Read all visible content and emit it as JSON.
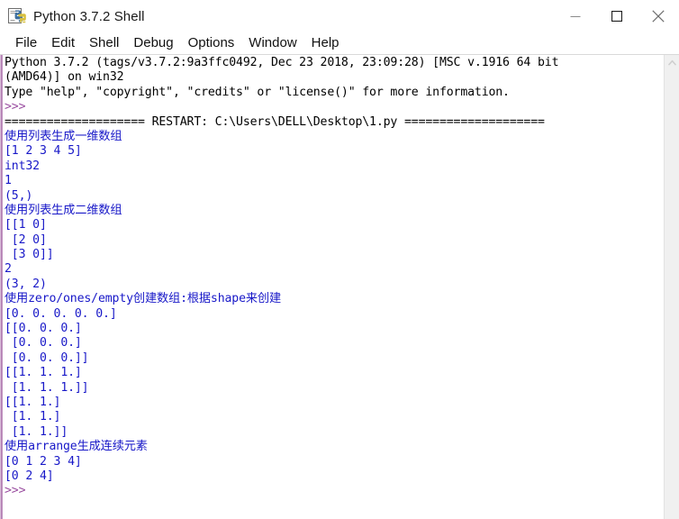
{
  "window": {
    "title": "Python 3.7.2 Shell",
    "icon": "python-idle-icon",
    "controls": {
      "minimize": "minimize-icon",
      "maximize": "maximize-icon",
      "close": "close-icon"
    }
  },
  "menubar": {
    "items": [
      {
        "label": "File"
      },
      {
        "label": "Edit"
      },
      {
        "label": "Shell"
      },
      {
        "label": "Debug"
      },
      {
        "label": "Options"
      },
      {
        "label": "Window"
      },
      {
        "label": "Help"
      }
    ]
  },
  "colors": {
    "output_blue": "#1818c8",
    "stdout_black": "#000000",
    "prompt_purple": "#9a4ea0",
    "left_border": "#b07ab0",
    "scrollbar_track": "#f0f0f0"
  },
  "shell": {
    "lines": [
      {
        "color": "black",
        "text": "Python 3.7.2 (tags/v3.7.2:9a3ffc0492, Dec 23 2018, 23:09:28) [MSC v.1916 64 bit"
      },
      {
        "color": "black",
        "text": "(AMD64)] on win32"
      },
      {
        "color": "black",
        "text": "Type \"help\", \"copyright\", \"credits\" or \"license()\" for more information."
      },
      {
        "color": "prompt",
        "text": ">>>"
      },
      {
        "color": "black",
        "text": "==================== RESTART: C:\\Users\\DELL\\Desktop\\1.py ===================="
      },
      {
        "color": "blue",
        "text": "使用列表生成一维数组"
      },
      {
        "color": "blue",
        "text": "[1 2 3 4 5]"
      },
      {
        "color": "blue",
        "text": "int32"
      },
      {
        "color": "blue",
        "text": "1"
      },
      {
        "color": "blue",
        "text": "(5,)"
      },
      {
        "color": "blue",
        "text": "使用列表生成二维数组"
      },
      {
        "color": "blue",
        "text": "[[1 0]"
      },
      {
        "color": "blue",
        "text": " [2 0]"
      },
      {
        "color": "blue",
        "text": " [3 0]]"
      },
      {
        "color": "blue",
        "text": "2"
      },
      {
        "color": "blue",
        "text": "(3, 2)"
      },
      {
        "color": "blue",
        "text": "使用zero/ones/empty创建数组:根据shape来创建"
      },
      {
        "color": "blue",
        "text": "[0. 0. 0. 0. 0.]"
      },
      {
        "color": "blue",
        "text": "[[0. 0. 0.]"
      },
      {
        "color": "blue",
        "text": " [0. 0. 0.]"
      },
      {
        "color": "blue",
        "text": " [0. 0. 0.]]"
      },
      {
        "color": "blue",
        "text": "[[1. 1. 1.]"
      },
      {
        "color": "blue",
        "text": " [1. 1. 1.]]"
      },
      {
        "color": "blue",
        "text": "[[1. 1.]"
      },
      {
        "color": "blue",
        "text": " [1. 1.]"
      },
      {
        "color": "blue",
        "text": " [1. 1.]]"
      },
      {
        "color": "blue",
        "text": "使用arrange生成连续元素"
      },
      {
        "color": "blue",
        "text": "[0 1 2 3 4]"
      },
      {
        "color": "blue",
        "text": "[0 2 4]"
      },
      {
        "color": "prompt",
        "text": ">>>"
      }
    ]
  },
  "scrollbar": {
    "up_arrow": "chevron-up-icon"
  }
}
